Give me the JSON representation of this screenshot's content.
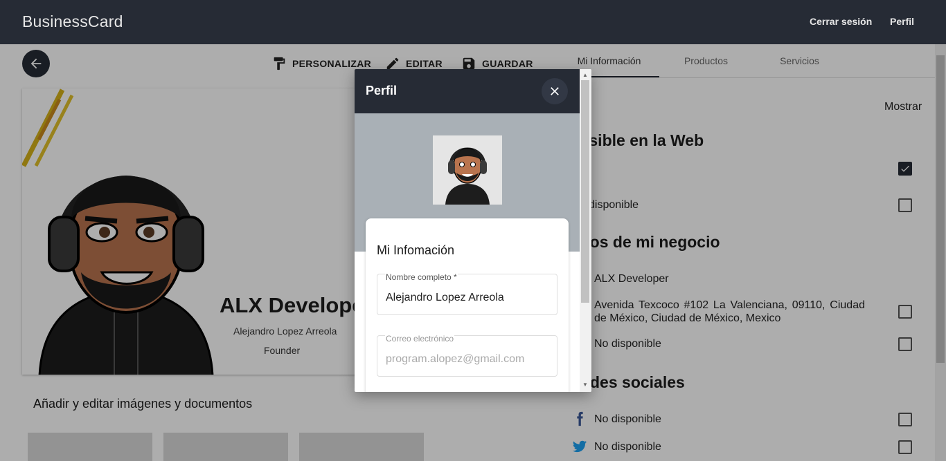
{
  "app": {
    "brand": "BusinessCard",
    "nav": {
      "logout": "Cerrar sesión",
      "profile": "Perfil"
    }
  },
  "toolbar": {
    "customize": "PERSONALIZAR",
    "edit": "EDITAR",
    "save": "GUARDAR"
  },
  "card": {
    "name": "ALX Developer",
    "full_name": "Alejandro Lopez Arreola",
    "role": "Founder"
  },
  "media": {
    "title": "Añadir y editar imágenes y documentos"
  },
  "tabs": [
    "Mi Información",
    "Productos",
    "Servicios"
  ],
  "info_panel": {
    "show_label": "Mostrar",
    "sections": [
      {
        "title": "isible en la Web"
      },
      {
        "title": "tos de mi negocio"
      },
      {
        "title": "des sociales"
      }
    ],
    "rows": {
      "web_unavailable": "disponible",
      "business_name": "ALX Developer",
      "address": "Avenida Texcoco #102 La Valenciana, 09110, Ciudad de México, Ciudad de México, Mexico",
      "phone": "No disponible",
      "facebook": "No disponible",
      "twitter": "No disponible"
    }
  },
  "dialog": {
    "title": "Perfil",
    "form_title": "Mi Infomación",
    "fields": {
      "name": {
        "label": "Nombre completo *",
        "value": "Alejandro Lopez Arreola"
      },
      "email": {
        "label": "Correo electrónico",
        "value": "program.alopez@gmail.com"
      }
    }
  },
  "colors": {
    "header_bg": "#262b35",
    "banner_bg": "#a9b0b6",
    "facebook": "#3b5998",
    "twitter": "#1da1f2"
  },
  "icons": [
    "back-arrow-icon",
    "paint-roller-icon",
    "pencil-icon",
    "floppy-disk-icon",
    "close-icon",
    "check-icon",
    "facebook-icon",
    "twitter-icon"
  ]
}
